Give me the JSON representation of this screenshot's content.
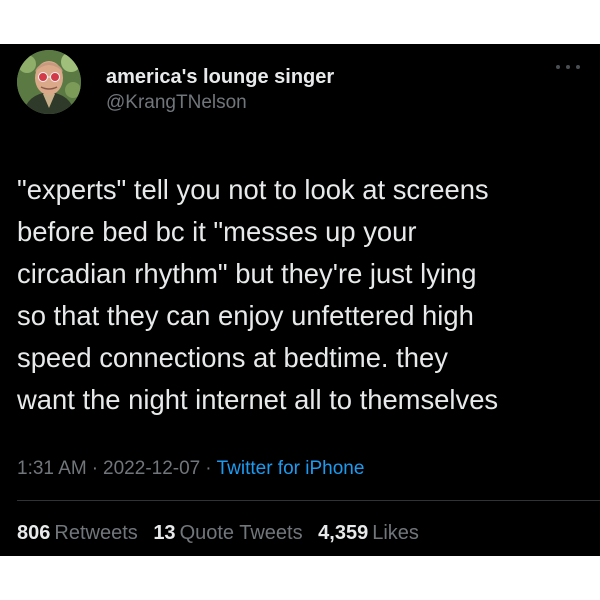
{
  "author": {
    "display_name": "america's lounge singer",
    "handle": "@KrangTNelson",
    "avatar_icon": "profile-photo"
  },
  "tweet": {
    "lines": [
      "\"experts\" tell you not to look at screens",
      "before bed bc it \"messes up your",
      "circadian rhythm\" but they're just lying",
      "so that they can enjoy unfettered high",
      "speed connections at bedtime. they",
      "want the night internet all to themselves"
    ]
  },
  "meta": {
    "time": "1:31 AM",
    "separator": "·",
    "date": "2022-12-07",
    "source": "Twitter for iPhone"
  },
  "stats": {
    "retweets_count": "806",
    "retweets_label": "Retweets",
    "quotes_count": "13",
    "quotes_label": "Quote Tweets",
    "likes_count": "4,359",
    "likes_label": "Likes"
  },
  "colors": {
    "background": "#000000",
    "text": "#e7e9ea",
    "secondary_text": "#71767b",
    "link": "#1d9bf0"
  }
}
